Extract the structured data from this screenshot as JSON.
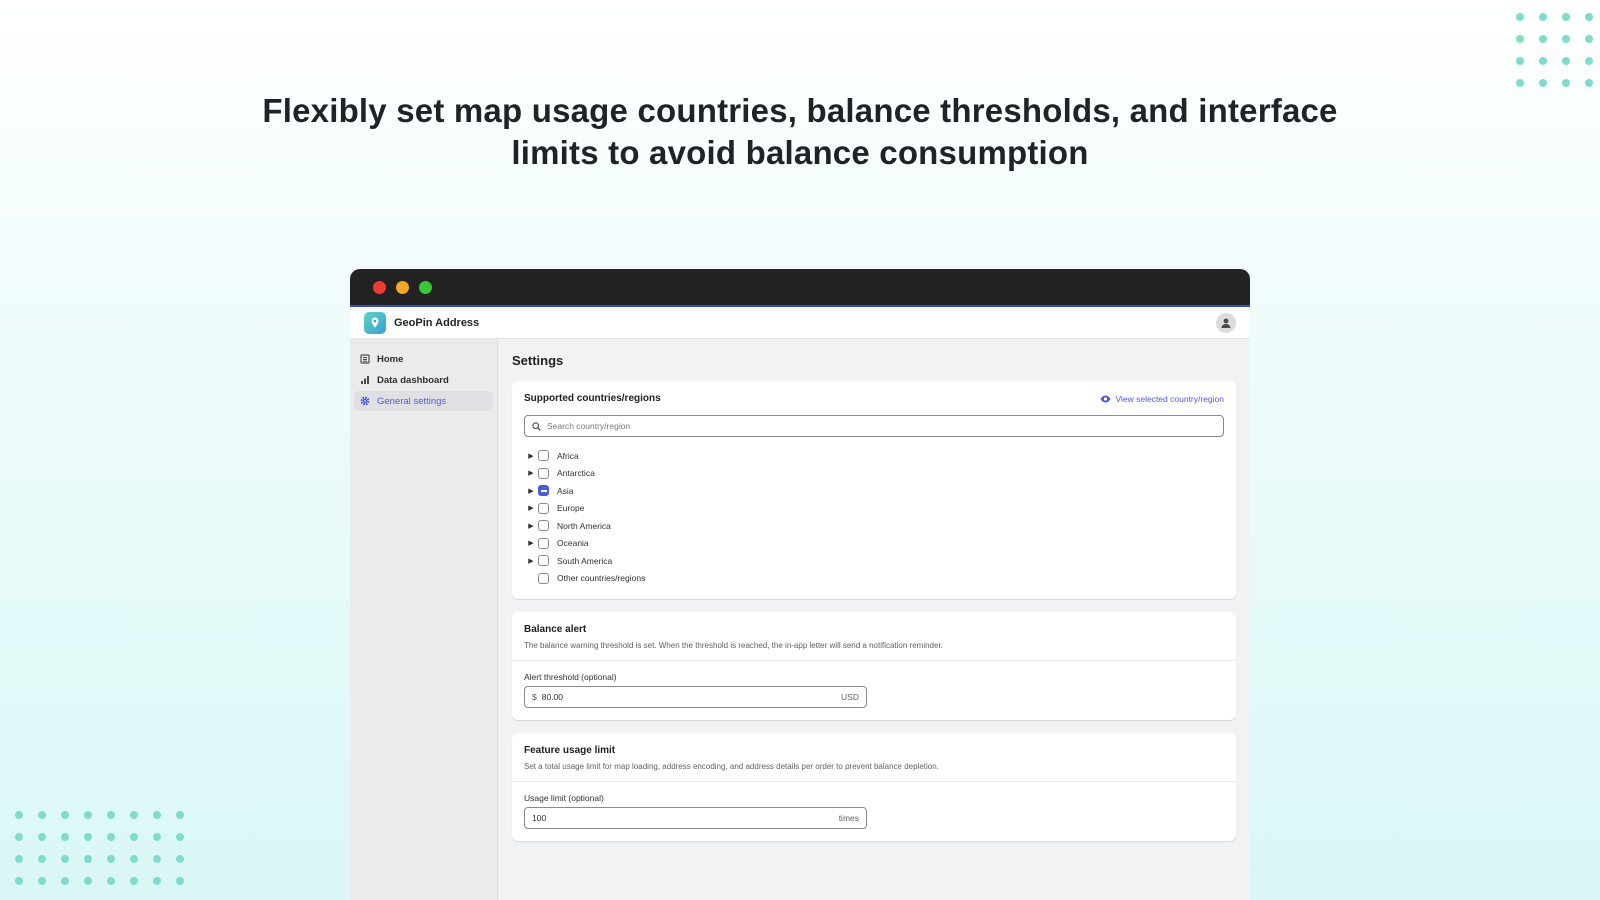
{
  "headline": {
    "line1": "Flexibly set map usage countries, balance thresholds, and interface",
    "line2": "limits to avoid balance consumption"
  },
  "app": {
    "name": "GeoPin Address",
    "brand_colors": {
      "accent": "#4f5bd5",
      "logo_start": "#5ed3c0",
      "logo_end": "#3a9fd6"
    }
  },
  "sidebar": {
    "items": [
      {
        "label": "Home",
        "icon": "home-icon"
      },
      {
        "label": "Data dashboard",
        "icon": "bar-chart-icon"
      },
      {
        "label": "General settings",
        "icon": "gear-icon",
        "active": true
      }
    ]
  },
  "page": {
    "title": "Settings"
  },
  "countries_card": {
    "title": "Supported countries/regions",
    "view_link": "View selected country/region",
    "search_placeholder": "Search country/region",
    "regions": [
      {
        "label": "Africa",
        "expandable": true,
        "state": "unchecked"
      },
      {
        "label": "Antarctica",
        "expandable": true,
        "state": "unchecked"
      },
      {
        "label": "Asia",
        "expandable": true,
        "state": "indeterminate"
      },
      {
        "label": "Europe",
        "expandable": true,
        "state": "unchecked"
      },
      {
        "label": "North America",
        "expandable": true,
        "state": "unchecked"
      },
      {
        "label": "Oceania",
        "expandable": true,
        "state": "unchecked"
      },
      {
        "label": "South America",
        "expandable": true,
        "state": "unchecked"
      },
      {
        "label": "Other countries/regions",
        "expandable": false,
        "state": "unchecked"
      }
    ]
  },
  "balance_alert": {
    "title": "Balance alert",
    "description": "The balance warning threshold is set. When the threshold is reached, the in-app letter will send a notification reminder.",
    "field_label": "Alert threshold (optional)",
    "prefix": "$",
    "value": "80.00",
    "suffix": "USD"
  },
  "usage_limit": {
    "title": "Feature usage limit",
    "description": "Set a total usage limit for map loading, address encoding, and address details per order to prevent balance depletion.",
    "field_label": "Usage limit (optional)",
    "value": "100",
    "suffix": "times"
  }
}
